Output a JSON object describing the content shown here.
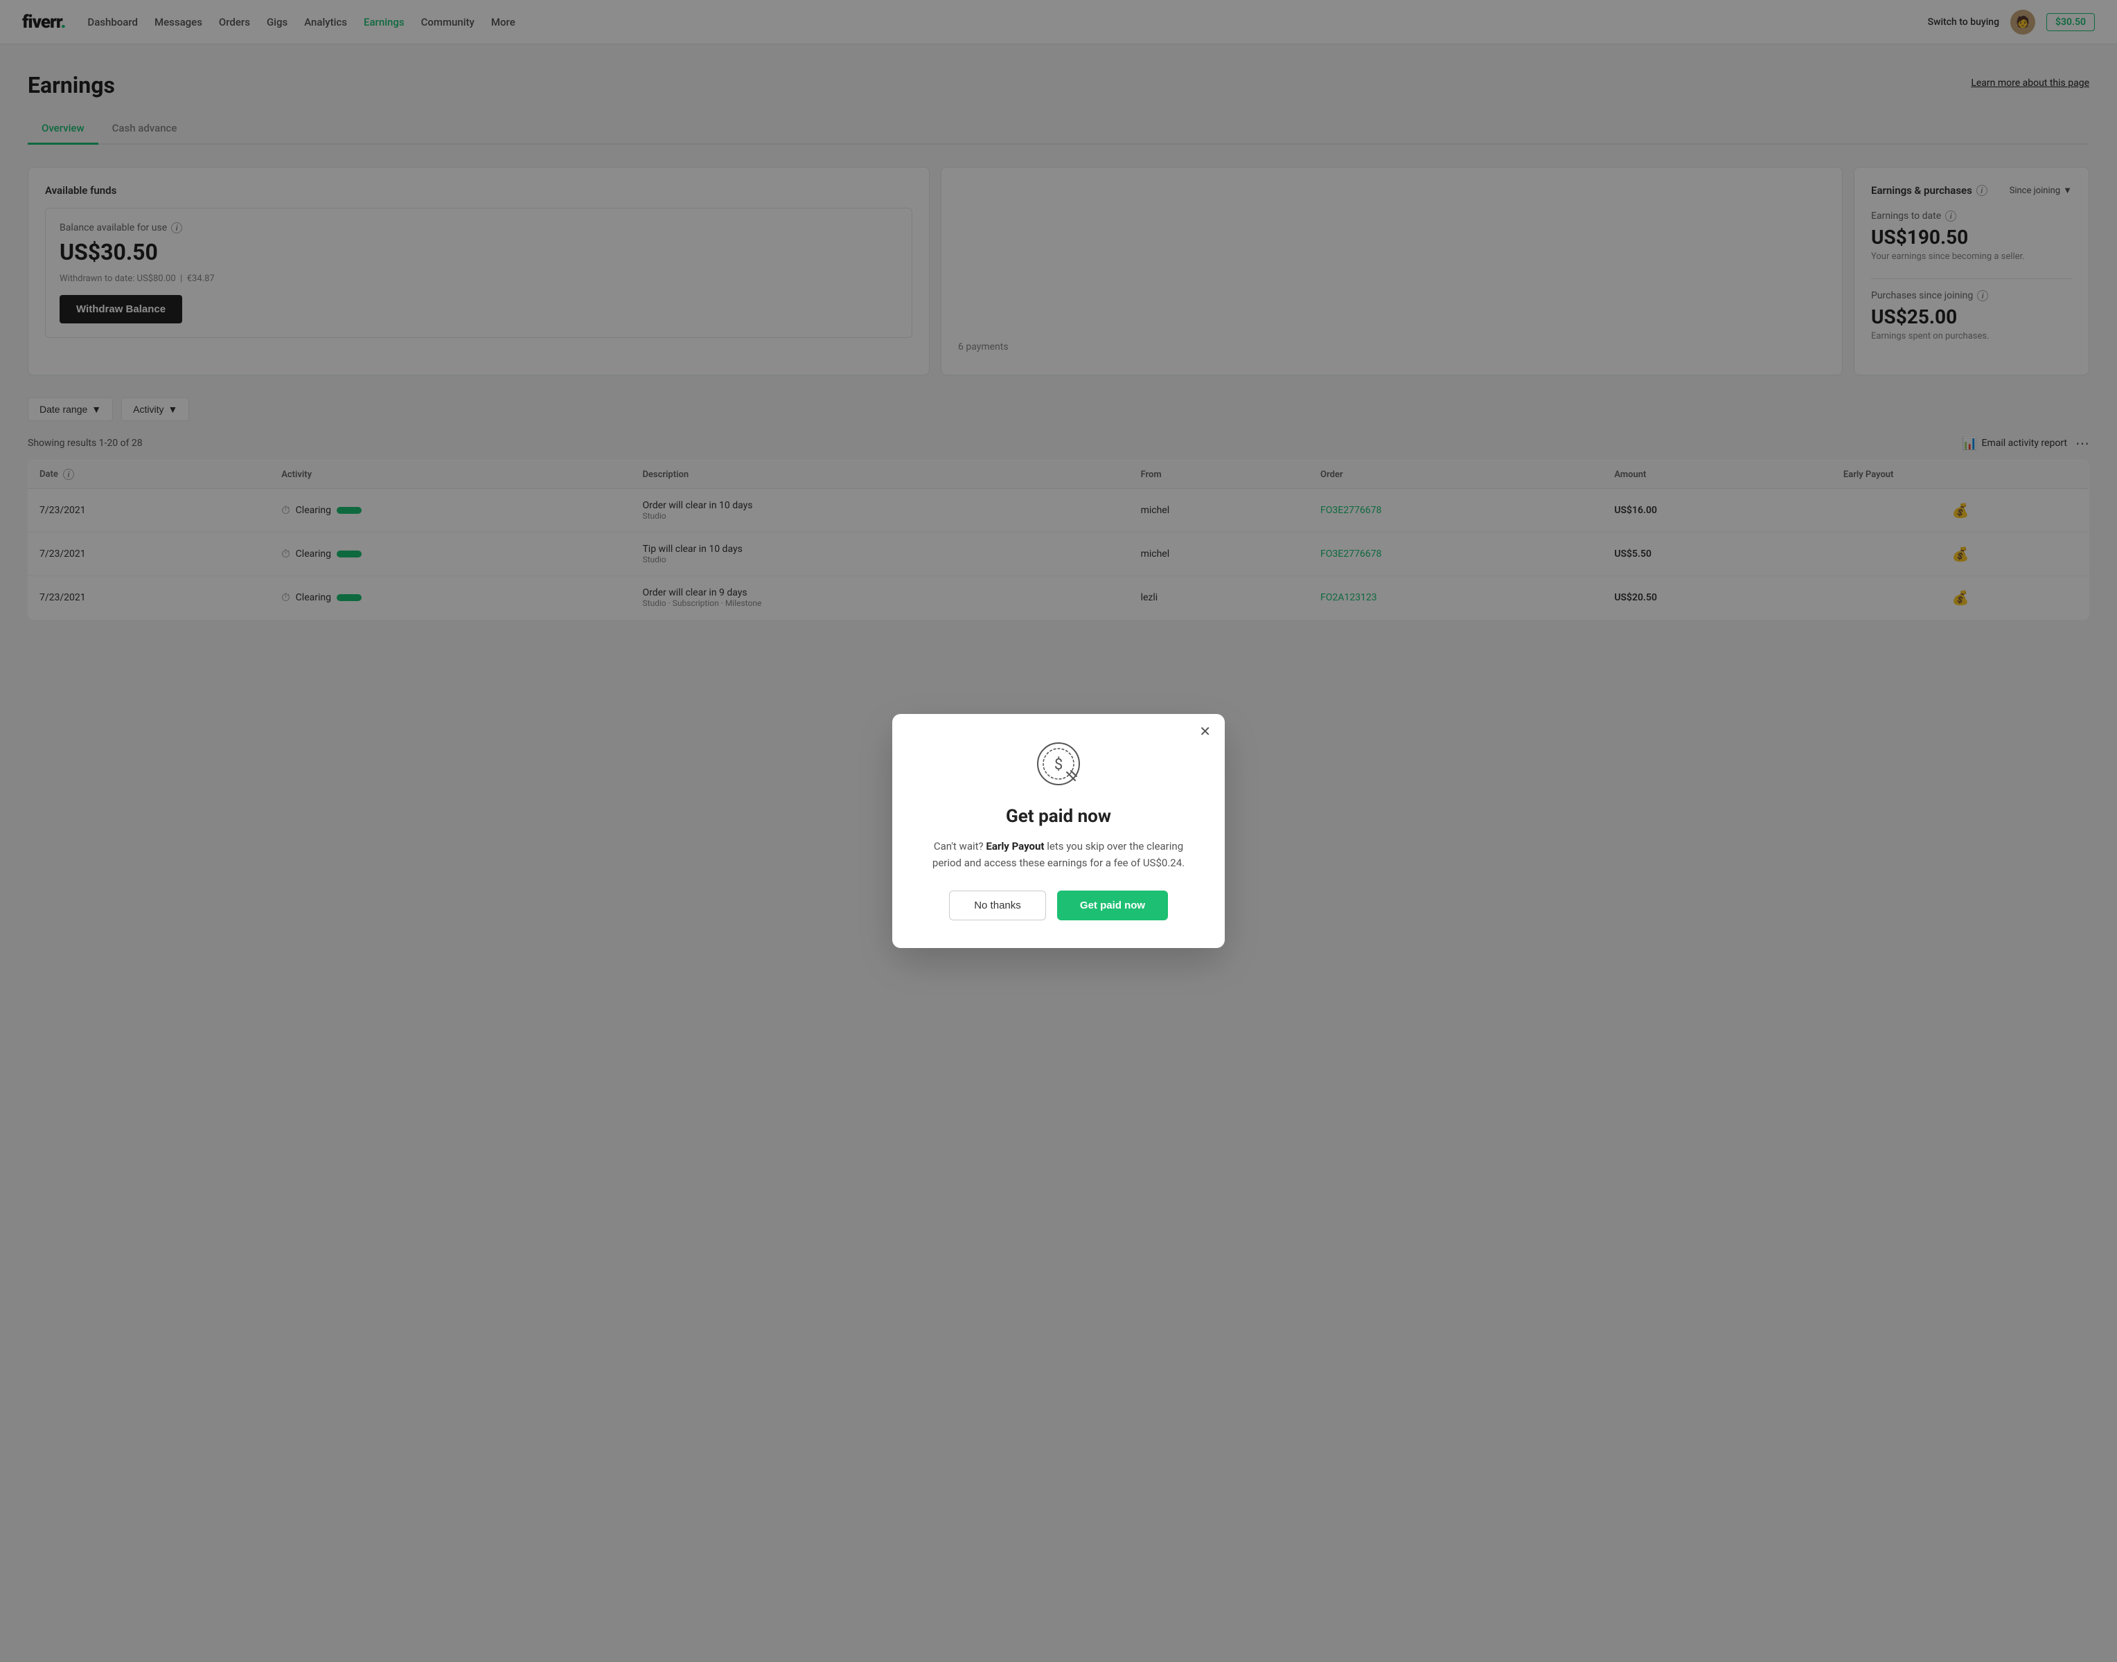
{
  "navbar": {
    "logo": "fiverr",
    "links": [
      {
        "label": "Dashboard",
        "active": false
      },
      {
        "label": "Messages",
        "active": false
      },
      {
        "label": "Orders",
        "active": false
      },
      {
        "label": "Gigs",
        "active": false
      },
      {
        "label": "Analytics",
        "active": false
      },
      {
        "label": "Earnings",
        "active": true
      },
      {
        "label": "Community",
        "active": false
      },
      {
        "label": "More",
        "active": false
      }
    ],
    "switch_buying": "Switch to buying",
    "balance": "$30.50"
  },
  "page": {
    "title": "Earnings",
    "learn_more": "Learn more about this page"
  },
  "tabs": [
    {
      "label": "Overview",
      "active": true
    },
    {
      "label": "Cash advance",
      "active": false
    }
  ],
  "available_funds": {
    "heading": "Available funds",
    "balance_label": "Balance available for use",
    "balance_amount": "US$30.50",
    "withdrawn_label": "Withdrawn to date:",
    "withdrawn_amount": "US$80.00",
    "withdrawn_eur": "€34.87",
    "withdraw_btn": "Withdraw Balance"
  },
  "clearing": {
    "payments": "6 payments"
  },
  "earnings_purchases": {
    "heading": "Earnings & purchases",
    "since_joining": "Since joining",
    "earnings_label": "Earnings to date",
    "earnings_amount": "US$190.50",
    "earnings_sub": "Your earnings since becoming a seller.",
    "purchases_label": "Purchases since joining",
    "purchases_amount": "US$25.00",
    "purchases_sub": "Earnings spent on purchases."
  },
  "filters": {
    "date_range": "Date range",
    "activity": "Activity"
  },
  "results": {
    "showing": "Showing results 1-20 of 28",
    "email_report": "Email activity report"
  },
  "table": {
    "headers": [
      "Date",
      "Activity",
      "Description",
      "From",
      "Order",
      "Amount",
      "Early Payout"
    ],
    "rows": [
      {
        "date": "7/23/2021",
        "activity": "Clearing",
        "desc_main": "Order will clear in 10 days",
        "desc_sub": "Studio",
        "from": "michel",
        "order": "FO3E2776678",
        "amount": "US$16.00",
        "early_payout": true
      },
      {
        "date": "7/23/2021",
        "activity": "Clearing",
        "desc_main": "Tip will clear in 10 days",
        "desc_sub": "Studio",
        "from": "michel",
        "order": "FO3E2776678",
        "amount": "US$5.50",
        "early_payout": true
      },
      {
        "date": "7/23/2021",
        "activity": "Clearing",
        "desc_main": "Order will clear in 9 days",
        "desc_sub": "Studio · Subscription · Milestone",
        "from": "lezli",
        "order": "FO2A123123",
        "amount": "US$20.50",
        "early_payout": true
      }
    ]
  },
  "modal": {
    "title": "Get paid now",
    "body_prefix": "Can't wait?",
    "body_bold": "Early Payout",
    "body_suffix": "lets you skip over the clearing period and access these earnings for a fee of US$0.24.",
    "btn_no": "No thanks",
    "btn_yes": "Get paid now",
    "icon": "💰"
  }
}
